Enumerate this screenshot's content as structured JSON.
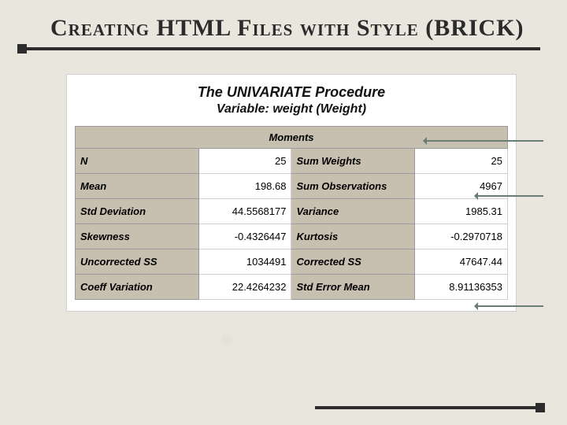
{
  "title": "Creating HTML Files with Style (BRICK)",
  "proc_title": "The UNIVARIATE Procedure",
  "variable_line": "Variable: weight (Weight)",
  "table": {
    "caption": "Moments",
    "rows": [
      {
        "l1": "N",
        "v1": "25",
        "l2": "Sum Weights",
        "v2": "25"
      },
      {
        "l1": "Mean",
        "v1": "198.68",
        "l2": "Sum Observations",
        "v2": "4967"
      },
      {
        "l1": "Std Deviation",
        "v1": "44.5568177",
        "l2": "Variance",
        "v2": "1985.31"
      },
      {
        "l1": "Skewness",
        "v1": "-0.4326447",
        "l2": "Kurtosis",
        "v2": "-0.2970718"
      },
      {
        "l1": "Uncorrected SS",
        "v1": "1034491",
        "l2": "Corrected SS",
        "v2": "47647.44"
      },
      {
        "l1": "Coeff Variation",
        "v1": "22.4264232",
        "l2": "Std Error Mean",
        "v2": "8.91136353"
      }
    ]
  },
  "chart_data": {
    "type": "table",
    "title": "Moments — UNIVARIATE Procedure, Variable: weight (Weight)",
    "statistics": {
      "N": 25,
      "Sum Weights": 25,
      "Mean": 198.68,
      "Sum Observations": 4967,
      "Std Deviation": 44.5568177,
      "Variance": 1985.31,
      "Skewness": -0.4326447,
      "Kurtosis": -0.2970718,
      "Uncorrected SS": 1034491,
      "Corrected SS": 47647.44,
      "Coeff Variation": 22.4264232,
      "Std Error Mean": 8.91136353
    }
  }
}
